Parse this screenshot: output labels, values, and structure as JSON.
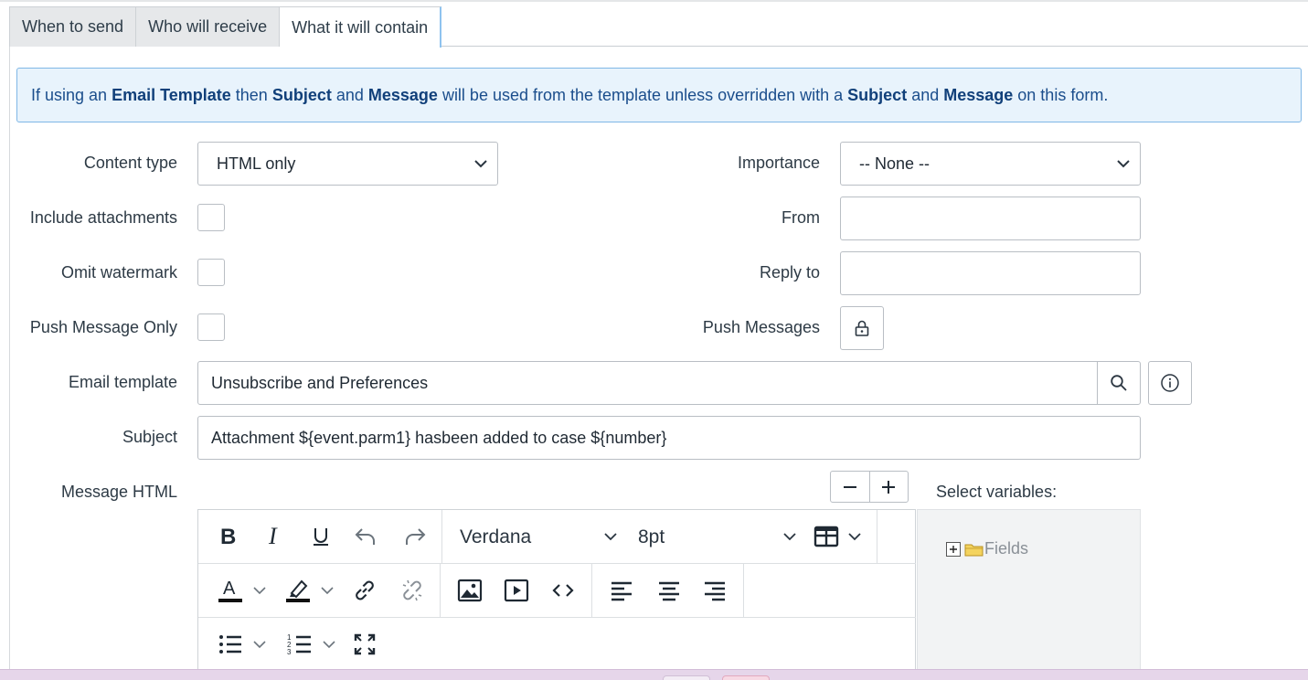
{
  "tabs": [
    {
      "label": "When to send",
      "active": false
    },
    {
      "label": "Who will receive",
      "active": false
    },
    {
      "label": "What it will contain",
      "active": true
    }
  ],
  "banner": {
    "t1": "If using an ",
    "b1": "Email Template",
    "t2": " then ",
    "b2": "Subject",
    "t3": " and ",
    "b3": "Message",
    "t4": " will be used from the template unless overridden with a ",
    "b4": "Subject",
    "t5": " and ",
    "b5": "Message",
    "t6": " on this form."
  },
  "form": {
    "content_type": {
      "label": "Content type",
      "value": "HTML only"
    },
    "include_attachments": {
      "label": "Include attachments",
      "checked": false
    },
    "omit_watermark": {
      "label": "Omit watermark",
      "checked": false
    },
    "push_message_only": {
      "label": "Push Message Only",
      "checked": false
    },
    "importance": {
      "label": "Importance",
      "value": "-- None --"
    },
    "from": {
      "label": "From",
      "value": ""
    },
    "reply_to": {
      "label": "Reply to",
      "value": ""
    },
    "push_messages": {
      "label": "Push Messages",
      "icon": "lock-icon"
    },
    "email_template": {
      "label": "Email template",
      "value": "Unsubscribe and Preferences"
    },
    "subject": {
      "label": "Subject",
      "value": "Attachment ${event.parm1} hasbeen added to case ${number}"
    },
    "message_html": {
      "label": "Message HTML"
    }
  },
  "editor": {
    "font_family": "Verdana",
    "font_size": "8pt"
  },
  "variables": {
    "title": "Select variables:",
    "tree": [
      {
        "label": "Fields",
        "expanded": false
      }
    ]
  },
  "colors": {
    "accent": "#8fc3ef",
    "banner_bg": "#e8f3fc",
    "banner_border": "#7fb7e6",
    "banner_text": "#1b4e8c",
    "taskbar": "#e6d6ea"
  }
}
